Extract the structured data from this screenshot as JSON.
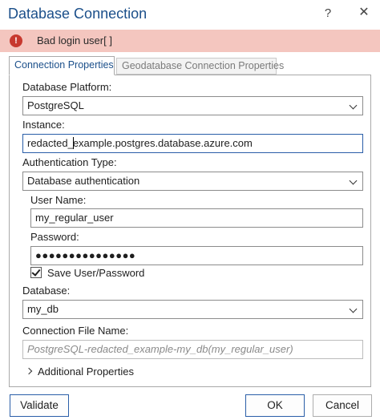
{
  "window": {
    "title": "Database Connection",
    "help_glyph": "?",
    "close_glyph": "✕"
  },
  "error": {
    "icon_glyph": "!",
    "message": "Bad login user[ ]"
  },
  "tabs": [
    {
      "label": "Connection Properties",
      "active": true
    },
    {
      "label": "Geodatabase Connection Properties",
      "active": false
    }
  ],
  "form": {
    "platform_label": "Database Platform:",
    "platform_value": "PostgreSQL",
    "instance_label": "Instance:",
    "instance_before_caret": "redacted_",
    "instance_after_caret": "example.postgres.database.azure.com",
    "auth_type_label": "Authentication Type:",
    "auth_type_value": "Database authentication",
    "username_label": "User Name:",
    "username_value": "my_regular_user",
    "password_label": "Password:",
    "password_mask": "●●●●●●●●●●●●●●●",
    "save_label": "Save User/Password",
    "save_checked": true,
    "database_label": "Database:",
    "database_value": "my_db",
    "conn_file_label": "Connection File Name:",
    "conn_file_placeholder": "PostgreSQL-redacted_example-my_db(my_regular_user)",
    "additional_label": "Additional Properties"
  },
  "buttons": {
    "validate": "Validate",
    "ok": "OK",
    "cancel": "Cancel"
  },
  "colors": {
    "title_blue": "#1b4f8a",
    "error_bg": "#f4c6bf",
    "error_icon": "#c7392f",
    "focus_border": "#2a5ea8"
  }
}
